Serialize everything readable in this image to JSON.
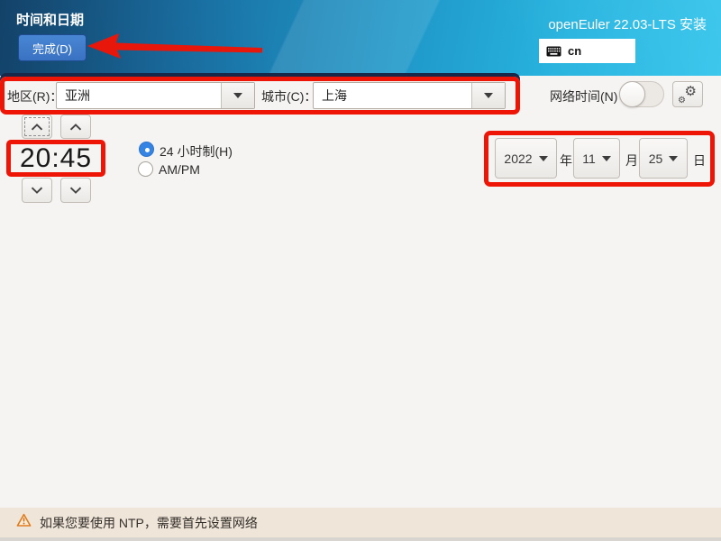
{
  "header": {
    "title": "时间和日期",
    "done_label": "完成(D)",
    "product": "openEuler 22.03-LTS 安装",
    "keyboard_layout": "cn"
  },
  "timezone": {
    "region_label": "地区(R)：",
    "region_value": "亚洲",
    "city_label": "城市(C)：",
    "city_value": "上海"
  },
  "network_time": {
    "label": "网络时间(N)",
    "state": "off"
  },
  "time": {
    "display": "20:45",
    "hours": "20",
    "minutes": "45",
    "format_24h_label": "24 小时制(H)",
    "ampm_label": "AM/PM",
    "selected_format": "24h"
  },
  "date": {
    "year": "2022",
    "year_suffix": "年",
    "month": "11",
    "month_suffix": "月",
    "day": "25",
    "day_suffix": "日"
  },
  "warning": {
    "message": "如果您要使用 NTP，需要首先设置网络"
  },
  "colors": {
    "accent_blue": "#3584e4",
    "annotation_red": "#ee1507",
    "banner_left": "#174a72",
    "banner_right": "#2fc3ec",
    "warning_bg": "#f0e5d9",
    "content_bg": "#f5f4f2"
  }
}
